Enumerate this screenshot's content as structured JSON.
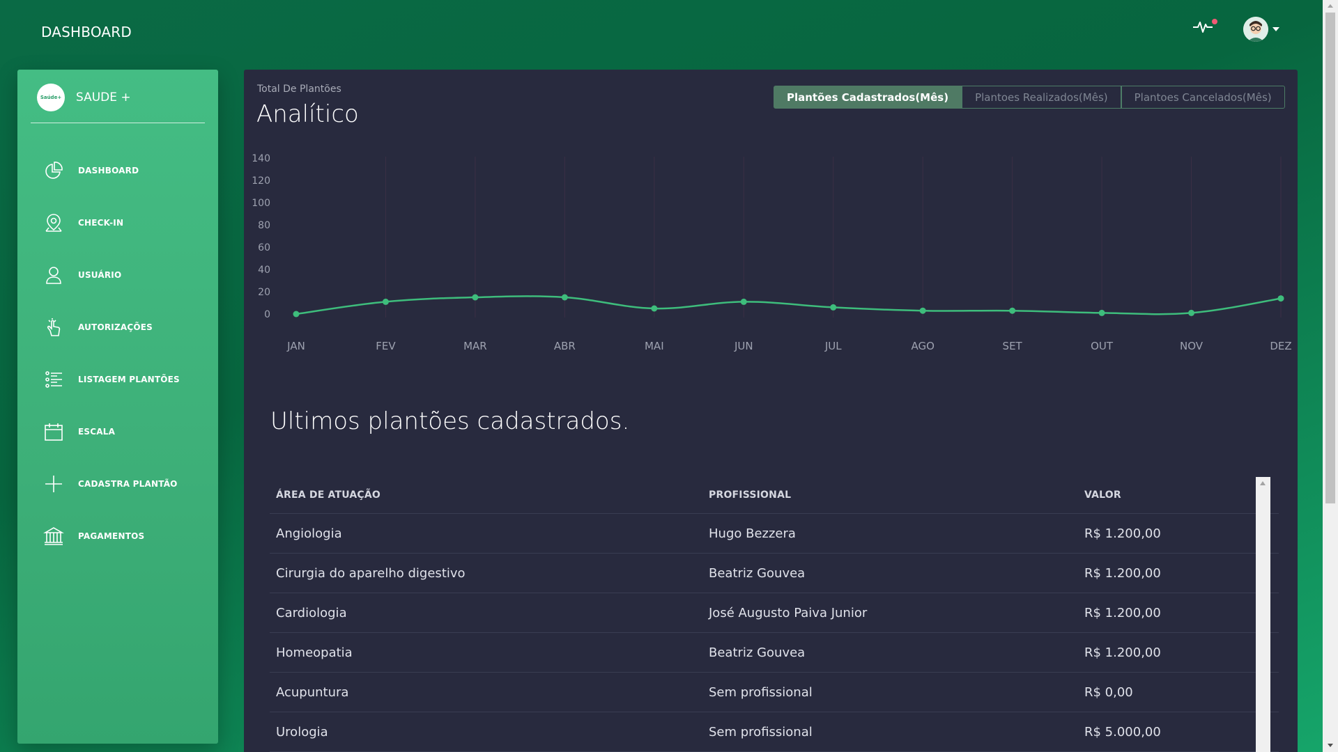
{
  "header": {
    "title": "DASHBOARD",
    "activity_icon": "activity-pulse-icon",
    "notification_color": "#f25a75",
    "avatar_icon": "user-avatar"
  },
  "sidebar": {
    "brand_logo_text": "Saúde+",
    "brand_name": "SAUDE +",
    "items": [
      {
        "label": "DASHBOARD",
        "icon": "pie-chart-icon"
      },
      {
        "label": "CHECK-IN",
        "icon": "location-pin-icon"
      },
      {
        "label": "USUÁRIO",
        "icon": "user-icon"
      },
      {
        "label": "AUTORIZAÇÕES",
        "icon": "hand-pointer-icon"
      },
      {
        "label": "LISTAGEM PLANTÕES",
        "icon": "list-icon"
      },
      {
        "label": "ESCALA",
        "icon": "calendar-icon"
      },
      {
        "label": "CADASTRA PLANTÃO",
        "icon": "plus-icon"
      },
      {
        "label": "PAGAMENTOS",
        "icon": "bank-icon"
      }
    ]
  },
  "card": {
    "subtitle": "Total De Plantões",
    "title": "Analítico",
    "tabs": [
      "Plantões Cadastrados(Mês)",
      "Plantoes Realizados(Mês)",
      "Plantoes Cancelados(Mês)"
    ],
    "active_tab": 0
  },
  "chart_data": {
    "type": "line",
    "categories": [
      "JAN",
      "FEV",
      "MAR",
      "ABR",
      "MAI",
      "JUN",
      "JUL",
      "AGO",
      "SET",
      "OUT",
      "NOV",
      "DEZ"
    ],
    "series": [
      {
        "values": [
          0,
          11,
          15,
          15,
          5,
          11,
          6,
          3,
          3,
          1,
          1,
          14
        ],
        "color": "#3ebd7c"
      }
    ],
    "ylim": [
      0,
      140
    ],
    "yticks": [
      0,
      20,
      40,
      60,
      80,
      100,
      120,
      140
    ],
    "grid": "vertical",
    "title": "",
    "xlabel": "",
    "ylabel": ""
  },
  "table": {
    "title": "Ultimos plantões cadastrados.",
    "headers": [
      "ÁREA DE ATUAÇÃO",
      "PROFISSIONAL",
      "VALOR"
    ],
    "rows": [
      [
        "Angiologia",
        "Hugo Bezzera",
        "R$ 1.200,00"
      ],
      [
        "Cirurgia do aparelho digestivo",
        "Beatriz Gouvea",
        "R$ 1.200,00"
      ],
      [
        "Cardiologia",
        "José Augusto Paiva Junior",
        "R$ 1.200,00"
      ],
      [
        "Homeopatia",
        "Beatriz Gouvea",
        "R$ 1.200,00"
      ],
      [
        "Acupuntura",
        "Sem profissional",
        "R$ 0,00"
      ],
      [
        "Urologia",
        "Sem profissional",
        "R$ 5.000,00"
      ]
    ]
  }
}
